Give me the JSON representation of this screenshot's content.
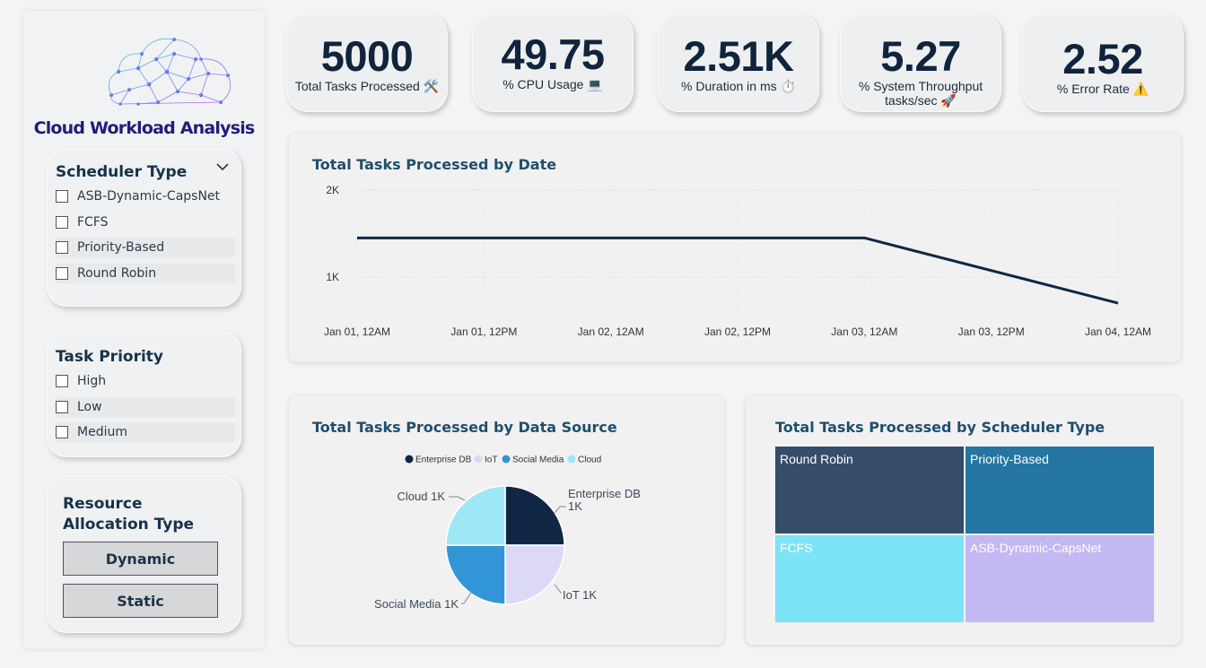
{
  "sidebar": {
    "app_title": "Cloud Workload Analysis",
    "scheduler_slicer": {
      "title": "Scheduler Type",
      "options": [
        "ASB-Dynamic-CapsNet",
        "FCFS",
        "Priority-Based",
        "Round Robin"
      ]
    },
    "priority_slicer": {
      "title": "Task Priority",
      "options": [
        "High",
        "Low",
        "Medium"
      ]
    },
    "resource_slicer": {
      "title": "Resource Allocation Type",
      "buttons": [
        "Dynamic",
        "Static"
      ]
    }
  },
  "kpis": [
    {
      "value": "5000",
      "label": "Total Tasks Processed 🛠️",
      "icon": "hammer-wrench-icon"
    },
    {
      "value": "49.75",
      "label": "% CPU Usage 💻",
      "icon": "laptop-icon"
    },
    {
      "value": "2.51K",
      "label": "%  Duration in ms ⏱️",
      "icon": "stopwatch-icon"
    },
    {
      "value": "5.27",
      "label": "% System Throughput tasks/sec 🚀",
      "icon": "rocket-icon"
    },
    {
      "value": "2.52",
      "label": "% Error Rate ⚠️",
      "icon": "warning-icon"
    }
  ],
  "line_chart": {
    "title": "Total Tasks Processed by Date",
    "y_ticks": [
      "2K",
      "1K"
    ],
    "x_ticks": [
      "Jan 01, 12AM",
      "Jan 01, 12PM",
      "Jan 02, 12AM",
      "Jan 02, 12PM",
      "Jan 03, 12AM",
      "Jan 03, 12PM",
      "Jan 04, 12AM"
    ]
  },
  "pie_chart": {
    "title": "Total Tasks Processed by Data Source",
    "legend": [
      "Enterprise DB",
      "IoT",
      "Social Media",
      "Cloud"
    ],
    "slice_labels": [
      "Enterprise DB\n1K",
      "IoT 1K",
      "Social Media 1K",
      "Cloud 1K"
    ]
  },
  "treemap": {
    "title": "Total Tasks Processed by Scheduler Type",
    "cells": [
      "Round Robin",
      "Priority-Based",
      "FCFS",
      "ASB-Dynamic-CapsNet"
    ]
  },
  "colors": {
    "navy": "#0f2744",
    "lavender": "#dcd9f7",
    "blue": "#3296d6",
    "sky": "#9de7f7",
    "treemap_round_robin": "#354d69",
    "treemap_priority": "#2475a1",
    "treemap_fcfs": "#7ce4f5",
    "treemap_asb": "#c4b8f3"
  },
  "chart_data": [
    {
      "type": "line",
      "title": "Total Tasks Processed by Date",
      "x": [
        "Jan 01, 12AM",
        "Jan 02, 12AM",
        "Jan 03, 12AM",
        "Jan 04, 12AM"
      ],
      "values": [
        1450,
        1450,
        1450,
        700
      ],
      "ylim": [
        0,
        2000
      ],
      "y_ticks": [
        1000,
        2000
      ],
      "grid": true
    },
    {
      "type": "pie",
      "title": "Total Tasks Processed by Data Source",
      "categories": [
        "Enterprise DB",
        "IoT",
        "Social Media",
        "Cloud"
      ],
      "values": [
        1250,
        1250,
        1250,
        1250
      ],
      "legend": "top"
    },
    {
      "type": "treemap",
      "title": "Total Tasks Processed by Scheduler Type",
      "categories": [
        "Round Robin",
        "Priority-Based",
        "FCFS",
        "ASB-Dynamic-CapsNet"
      ],
      "values": [
        1250,
        1250,
        1250,
        1250
      ]
    }
  ]
}
